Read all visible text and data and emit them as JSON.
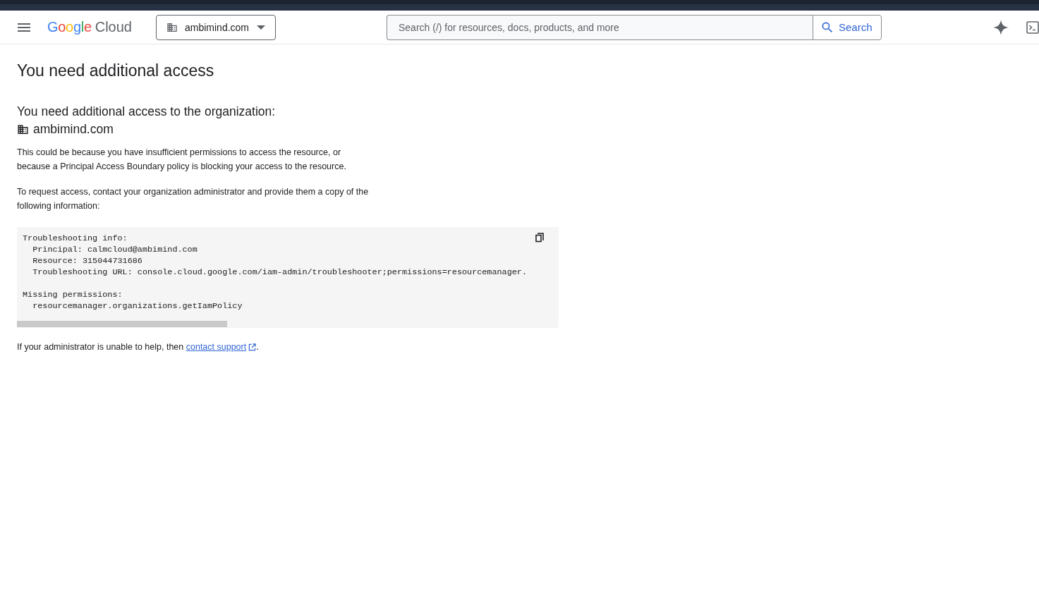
{
  "header": {
    "logo": {
      "brand": "Google",
      "product": "Cloud"
    },
    "org_picker": {
      "label": "ambimind.com"
    },
    "search": {
      "placeholder": "Search (/) for resources, docs, products, and more",
      "button": "Search"
    }
  },
  "page": {
    "title": "You need additional access",
    "subtitle": "You need additional access to the organization:",
    "organization": "ambimind.com",
    "paragraphs": [
      "This could be because you have insufficient permissions to access the resource, or because a Principal Access Boundary policy is blocking your access to the resource.",
      "To request access, contact your organization administrator and provide them a copy of the following information:"
    ],
    "code_blocks": [
      [
        "Troubleshooting info:",
        "  Principal: calmcloud@ambimind.com",
        "  Resource: 315044731686",
        "  Troubleshooting URL: console.cloud.google.com/iam-admin/troubleshooter;permissions=resourcemanager."
      ],
      [
        "Missing permissions:",
        "  resourcemanager.organizations.getIamPolicy"
      ]
    ],
    "footer": {
      "text": "If your administrator is unable to help, then",
      "link": "contact support",
      "end": "."
    }
  }
}
